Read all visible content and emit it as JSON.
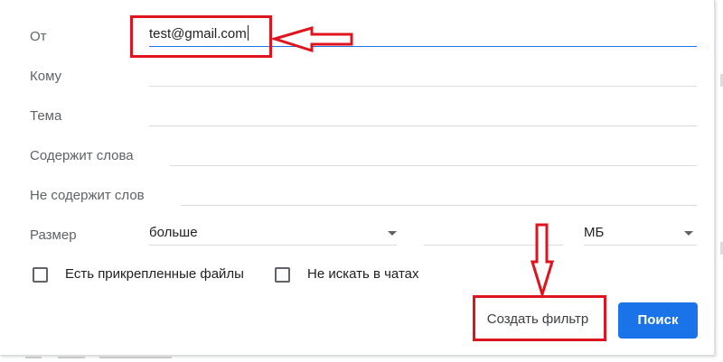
{
  "form": {
    "from_label": "От",
    "from_value": "test@gmail.com",
    "to_label": "Кому",
    "to_value": "",
    "subject_label": "Тема",
    "subject_value": "",
    "has_words_label": "Содержит слова",
    "has_words_value": "",
    "no_words_label": "Не содержит слов",
    "no_words_value": "",
    "size_label": "Размер",
    "size_operator": "больше",
    "size_value": "",
    "size_unit": "МБ",
    "has_attachment_label": "Есть прикрепленные файлы",
    "exclude_chats_label": "Не искать в чатах"
  },
  "buttons": {
    "create_filter_label": "Создать фильтр",
    "search_label": "Поиск"
  },
  "colors": {
    "primary": "#1a73e8",
    "annotation": "#e0141e",
    "label_text": "#5f6368"
  },
  "icons": {
    "dropdown": "chevron-down-icon",
    "annotation_arrow_left": "arrow-left-icon",
    "annotation_arrow_down": "arrow-down-icon"
  }
}
